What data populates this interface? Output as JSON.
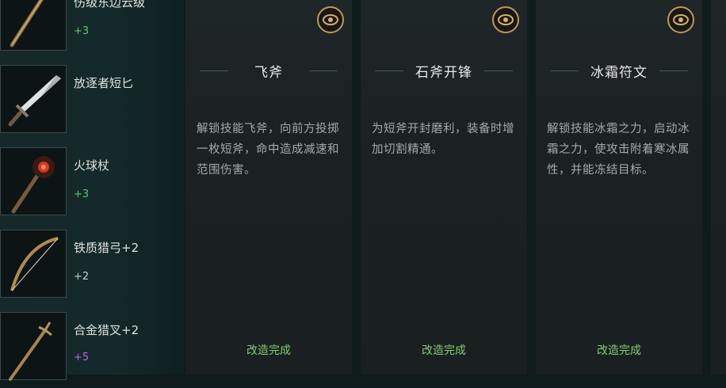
{
  "weapons": [
    {
      "name": "伤级东边云级",
      "bonus": "+3",
      "bonus_color": "#5fc07a"
    },
    {
      "name": "放逐者短匕",
      "bonus": "",
      "bonus_color": "#5fc07a"
    },
    {
      "name": "火球杖",
      "bonus": "+3",
      "bonus_color": "#5fc07a"
    },
    {
      "name": "铁质猎弓+2",
      "bonus": "+2",
      "bonus_color": "#c8cccc"
    },
    {
      "name": "合金猎叉+2",
      "bonus": "+5",
      "bonus_color": "#b06ad8"
    }
  ],
  "cards": [
    {
      "title": "飞斧",
      "desc": "解锁技能飞斧，向前方投掷一枚短斧，命中造成减速和范围伤害。",
      "status": "改造完成",
      "icon": "eye-icon"
    },
    {
      "title": "石斧开锋",
      "desc": "为短斧开封磨利，装备时增加切割精通。",
      "status": "改造完成",
      "icon": "eye-icon"
    },
    {
      "title": "冰霜符文",
      "desc": "解锁技能冰霜之力，启动冰霜之力，使攻击附着寒冰属性，并能冻结目标。",
      "status": "改造完成",
      "icon": "eye-icon"
    }
  ],
  "colors": {
    "accent_gold": "#b99a5b",
    "status_green": "#7fd06f"
  }
}
